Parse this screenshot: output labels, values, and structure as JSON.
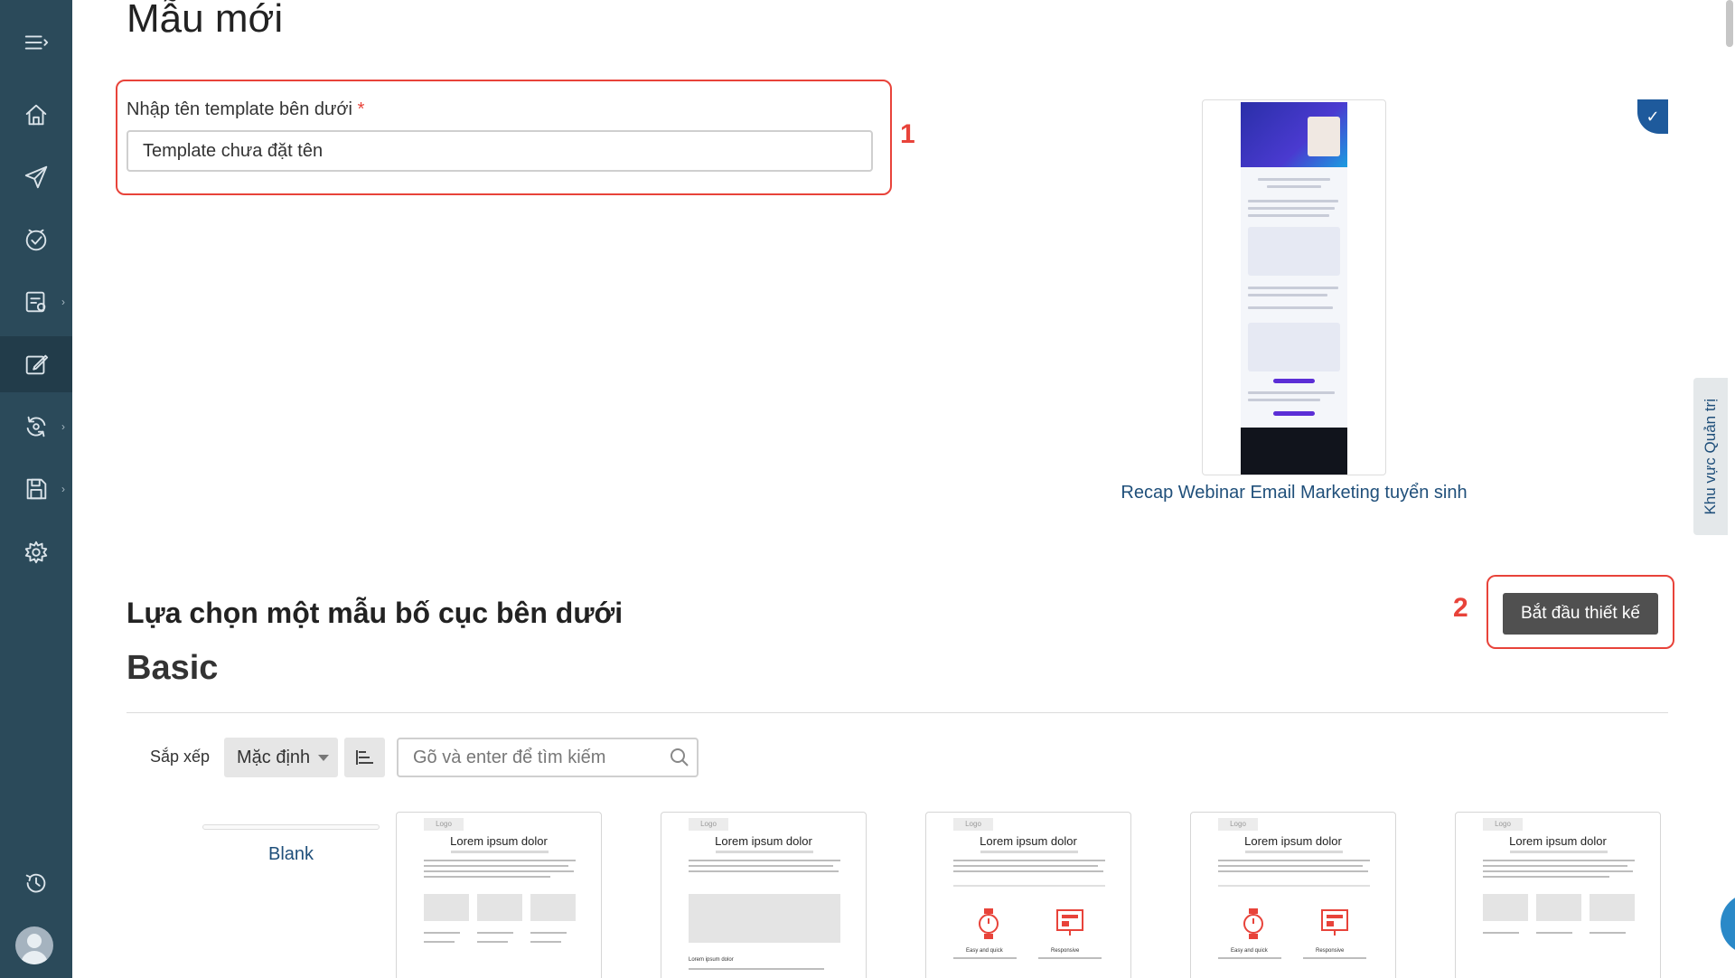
{
  "page": {
    "title": "Mẫu mới"
  },
  "template_name": {
    "label": "Nhập tên template bên dưới",
    "required_mark": "*",
    "value": "Template chưa đặt tên",
    "annotation": "1"
  },
  "preview": {
    "caption": "Recap Webinar Email Marketing tuyển sinh"
  },
  "side_tab": {
    "label": "Khu vực Quản trị"
  },
  "layout_section": {
    "title": "Lựa chọn một mẫu bố cục bên dưới",
    "category": "Basic",
    "start_button": "Bắt đầu thiết kế",
    "annotation": "2"
  },
  "toolbar": {
    "sort_label": "Sắp xếp",
    "sort_value": "Mặc định",
    "search_placeholder": "Gõ và enter để tìm kiếm"
  },
  "templates": {
    "blank_label": "Blank",
    "cards": [
      {
        "logo": "Logo",
        "heading": "Lorem ipsum dolor",
        "variant": "three-columns"
      },
      {
        "logo": "Logo",
        "heading": "Lorem ipsum dolor",
        "variant": "wide-image",
        "caption": "Lorem ipsum dolor"
      },
      {
        "logo": "Logo",
        "heading": "Lorem ipsum dolor",
        "variant": "icons",
        "col1": "Easy and quick",
        "col2": "Responsive"
      },
      {
        "logo": "Logo",
        "heading": "Lorem ipsum dolor",
        "variant": "icons",
        "col1": "Easy and quick",
        "col2": "Responsive"
      },
      {
        "logo": "Logo",
        "heading": "Lorem ipsum dolor",
        "variant": "three-columns"
      }
    ]
  },
  "colors": {
    "sidebar": "#2b4a5a",
    "highlight": "#e8433a",
    "link": "#1f4f7a",
    "button": "#505050"
  },
  "sidebar": {
    "icons": [
      "menu-icon",
      "home-icon",
      "send-icon",
      "check-badge-icon",
      "report-icon",
      "edit-template-icon",
      "sync-icon",
      "save-icon",
      "settings-icon",
      "history-icon"
    ]
  }
}
